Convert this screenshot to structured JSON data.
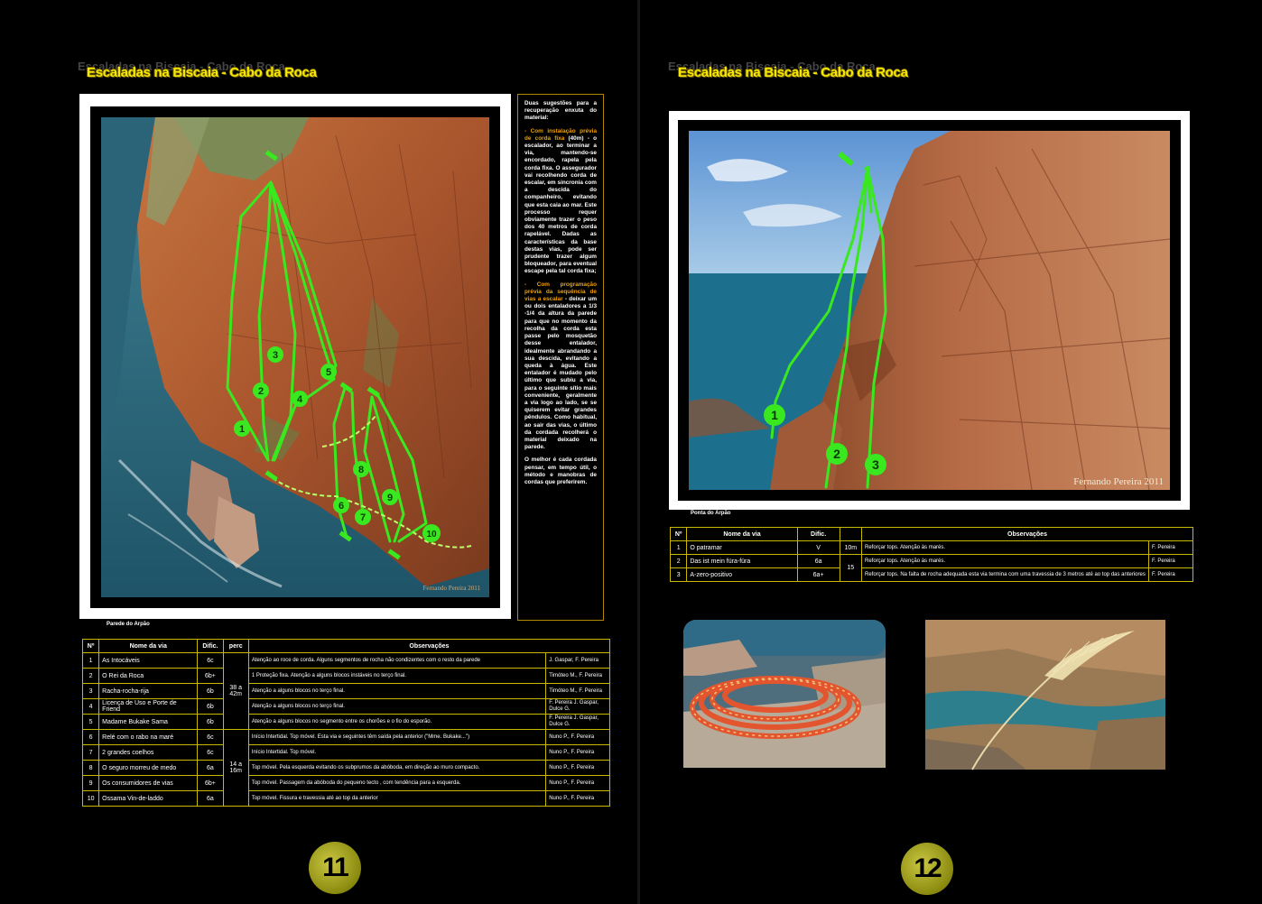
{
  "header_title": "Escaladas na Biscaia - Cabo da Roca",
  "left": {
    "page_number": "11",
    "photo_caption": "Parede do Arpão",
    "watermark": "Fernando Pereira 2011",
    "route_markers": [
      "1",
      "2",
      "3",
      "4",
      "5",
      "6",
      "7",
      "8",
      "9",
      "10"
    ],
    "sidebar": {
      "intro": "Duas sugestões para a recuperação enxuta do material:",
      "p1_highlight": "- Com instalação prévia de corda fixa",
      "p1_text": " (40m) - o escalador, ao terminar a via, mantendo-se encordado, rapela pela corda fixa. O assegurador vai recolhendo corda de escalar, em sincronia com a descida do companheiro, evitando que esta caia ao mar. Este processo requer obviamente trazer o peso dos 40 metros de corda rapelável. Dadas as características da base destas vias, pode ser prudente trazer algum bloqueador, para eventual escape pela tal corda fixa;",
      "p2_highlight": "- Com programação prévia da sequência de vias a escalar",
      "p2_text": " - deixar um ou dois entaladores a 1/3 -1/4 da altura da parede para que no momento da recolha da corda esta passe pelo mosquetão desse entalador, idealmente abrandando a sua descida, evitando a queda à água. Este entalador é mudado pelo último que subiu a via, para o seguinte sítio mais conveniente, geralmente a via logo ao lado, se se quiserem evitar grandes pêndulos. Como habitual, ao sair das vias, o último da cordada recolherá o material deixado na parede.",
      "p3": "O melhor é cada cordada pensar, em tempo útil, o método e manobras de cordas que preferirem."
    },
    "table": {
      "headers": [
        "Nº",
        "Nome da via",
        "Dific.",
        "perc",
        "Observações"
      ],
      "perc_groups": [
        "38 a 42m",
        "14 a 16m"
      ],
      "rows": [
        {
          "n": "1",
          "name": "As Intocáveis",
          "grade": "6c",
          "obs": "Atenção ao roce de corda. Alguns segmentos de rocha não condizentes com o resto da parede",
          "auth": "J. Gaspar, F. Pereira"
        },
        {
          "n": "2",
          "name": "O Rei da Roca",
          "grade": "6b+",
          "obs": "1 Proteção fixa. Atenção a alguns blocos instáveis no terço final.",
          "auth": "Timóteo M., F. Pereira"
        },
        {
          "n": "3",
          "name": "Racha-rocha-rija",
          "grade": "6b",
          "obs": "Atenção a alguns blocos no terço final.",
          "auth": "Timóteo M., F. Pereira"
        },
        {
          "n": "4",
          "name": "Licença de Uso e Porte de Friend",
          "grade": "6b",
          "obs": "Atenção a alguns blocos no terço final.",
          "auth": "F. Pereira J. Gaspar, Dulce G."
        },
        {
          "n": "5",
          "name": "Madame Bukake Sama",
          "grade": "6b",
          "obs": "Atenção a alguns blocos no segmento entre os chorões e o fio do esporão.",
          "auth": "F. Pereira J. Gaspar, Dulce G."
        },
        {
          "n": "6",
          "name": "Relé com o rabo na maré",
          "grade": "6c",
          "obs": "Início Intertidal. Top móvel. Esta via e seguintes têm saída pela anterior (\"Mme. Bukake...\")",
          "auth": "Nuno P., F. Pereira"
        },
        {
          "n": "7",
          "name": "2 grandes coelhos",
          "grade": "6c",
          "obs": "Início Intertidal. Top móvel.",
          "auth": "Nuno P., F. Pereira"
        },
        {
          "n": "8",
          "name": "O seguro morreu de medo",
          "grade": "6a",
          "obs": "Top móvel. Pela esquerda evitando os subprumos da abóboda, em direção ao muro compacto.",
          "auth": "Nuno P., F. Pereira"
        },
        {
          "n": "9",
          "name": "Os consumidores de vias",
          "grade": "6b+",
          "obs": "Top móvel. Passagem da abóboda do pequeno tecto , com tendência para a esquerda.",
          "auth": "Nuno P., F. Pereira"
        },
        {
          "n": "10",
          "name": "Ossama Vin-de-laddo",
          "grade": "6a",
          "obs": "Top móvel. Fissura e travessia até ao top da anterior",
          "auth": "Nuno P., F. Pereira"
        }
      ]
    }
  },
  "right": {
    "page_number": "12",
    "photo_caption": "Ponta do Arpão",
    "watermark": "Fernando Pereira 2011",
    "route_markers": [
      "1",
      "2",
      "3"
    ],
    "table": {
      "headers": [
        "Nº",
        "Nome da via",
        "Dific.",
        "",
        "Observações"
      ],
      "perc_groups": [
        "10m",
        "15"
      ],
      "rows": [
        {
          "n": "1",
          "name": "O patramar",
          "grade": "V",
          "obs": "Reforçar tops.  Atenção às marés.",
          "auth": "F. Pereira"
        },
        {
          "n": "2",
          "name": "Das ist mein füra-füra",
          "grade": "6a",
          "obs": "Reforçar tops. Atenção às marés.",
          "auth": "F. Pereira"
        },
        {
          "n": "3",
          "name": "A-zero-positivo",
          "grade": "6a+",
          "obs": "Reforçar tops. Na falta de rocha adequada esta via termina com uma travessia de 3 metros até ao top das anteriores",
          "auth": "F. Pereira"
        }
      ]
    }
  },
  "colors": {
    "accent_yellow": "#f6e800",
    "route_green": "#39e81f",
    "table_border": "#c8b800",
    "sidebar_highlight": "#f0a000",
    "rock": "#b8623a",
    "sea": "#2e6c8a"
  }
}
